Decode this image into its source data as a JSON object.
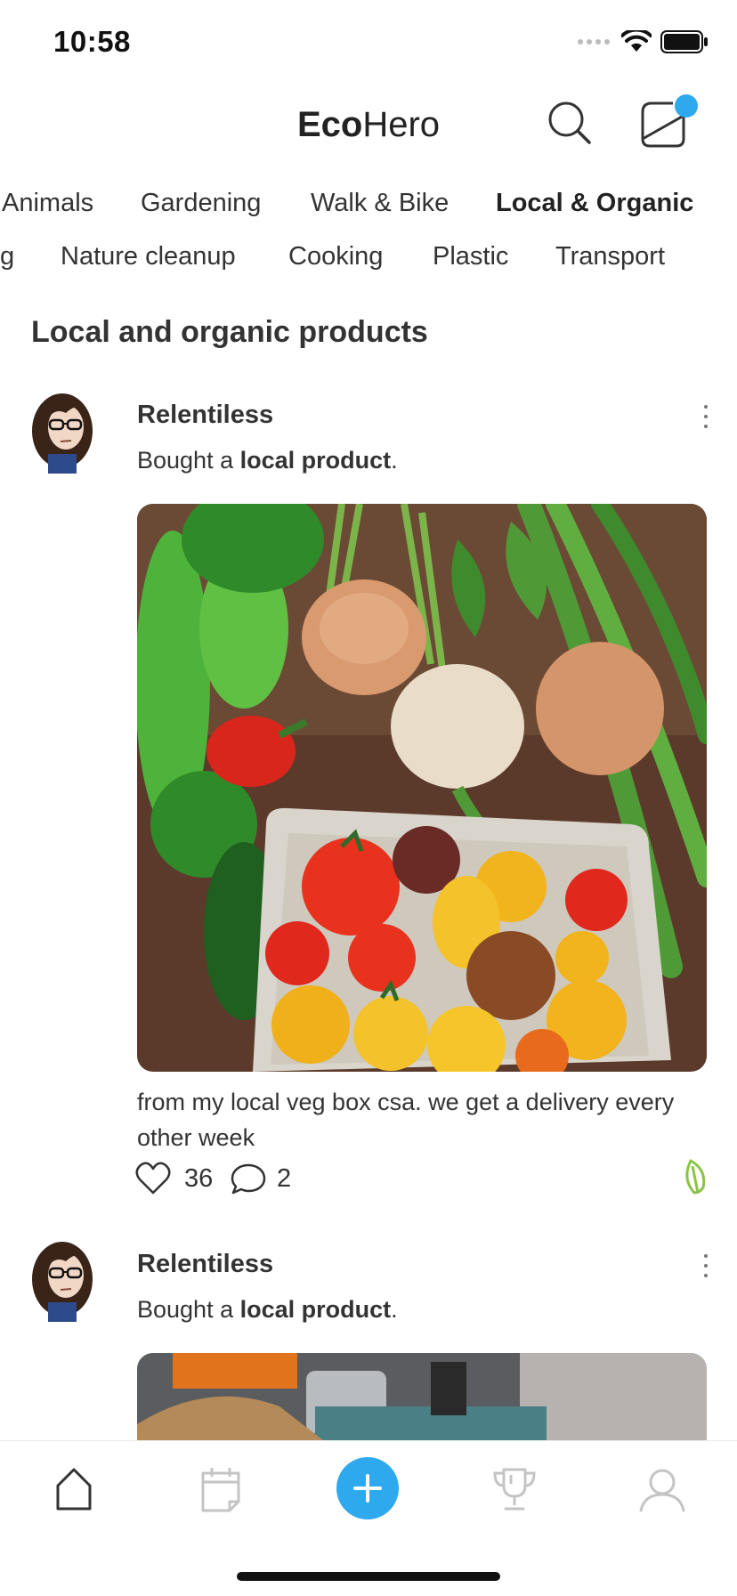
{
  "status_bar": {
    "time": "10:58"
  },
  "header": {
    "brand_bold": "Eco",
    "brand_regular": "Hero"
  },
  "categories": {
    "row1": [
      "Animals",
      "Gardening",
      "Walk & Bike",
      "Local & Organic"
    ],
    "row2": [
      "g",
      "Nature cleanup",
      "Cooking",
      "Plastic",
      "Transport"
    ],
    "active": "Local & Organic"
  },
  "section_title": "Local and organic products",
  "posts": [
    {
      "username": "Relentiless",
      "activity_prefix": "Bought a ",
      "activity_bold": "local product",
      "activity_suffix": ".",
      "caption": "from my local veg box csa. we get a delivery every other week",
      "likes": "36",
      "comments": "2"
    },
    {
      "username": "Relentiless",
      "activity_prefix": "Bought a ",
      "activity_bold": "local product",
      "activity_suffix": "."
    }
  ],
  "colors": {
    "accent": "#2fa9ee",
    "leaf": "#8bc34a",
    "notification_dot": "#2fa9ee"
  },
  "tabbar": [
    "home-icon",
    "calendar-icon",
    "add-icon",
    "trophy-icon",
    "profile-icon"
  ]
}
